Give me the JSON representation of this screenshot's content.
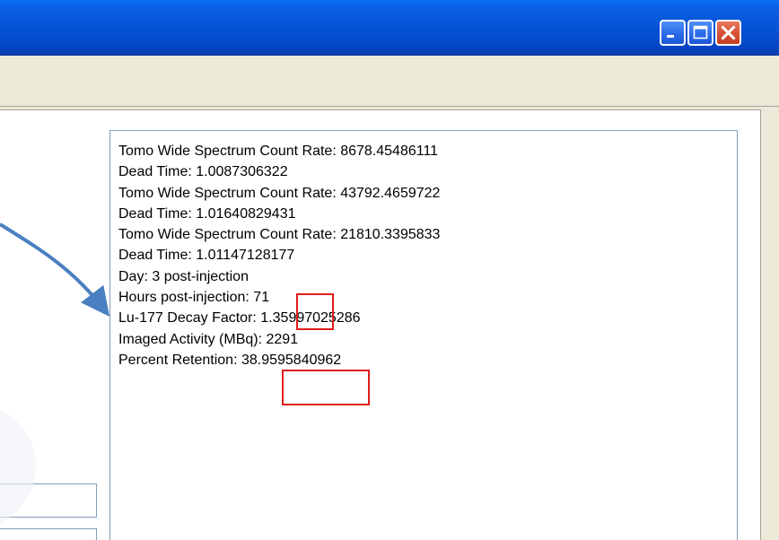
{
  "window": {
    "title": ""
  },
  "title_buttons": {
    "minimize_icon": "minimize-icon",
    "maximize_icon": "maximize-icon",
    "close_icon": "close-icon"
  },
  "output_panel": {
    "lines": [
      "Tomo Wide Spectrum Count Rate: 8678.45486111",
      "Dead Time: 1.0087306322",
      "Tomo Wide Spectrum Count Rate: 43792.4659722",
      "Dead Time: 1.01640829431",
      "Tomo Wide Spectrum Count Rate: 21810.3395833",
      "Dead Time: 1.01147128177",
      "Day: 3 post-injection",
      "Hours post-injection: 71",
      "Lu-177 Decay Factor: 1.35997025286",
      "Imaged Activity (MBq): 2291",
      "Percent Retention: 38.9595840962"
    ]
  },
  "annotations": {
    "arrow_color": "#4a7fc1",
    "highlight_color": "#e11b1b"
  },
  "colors": {
    "titlebar": "#0553d6",
    "window_face": "#ece9d8",
    "field_border": "#7f9db9"
  }
}
